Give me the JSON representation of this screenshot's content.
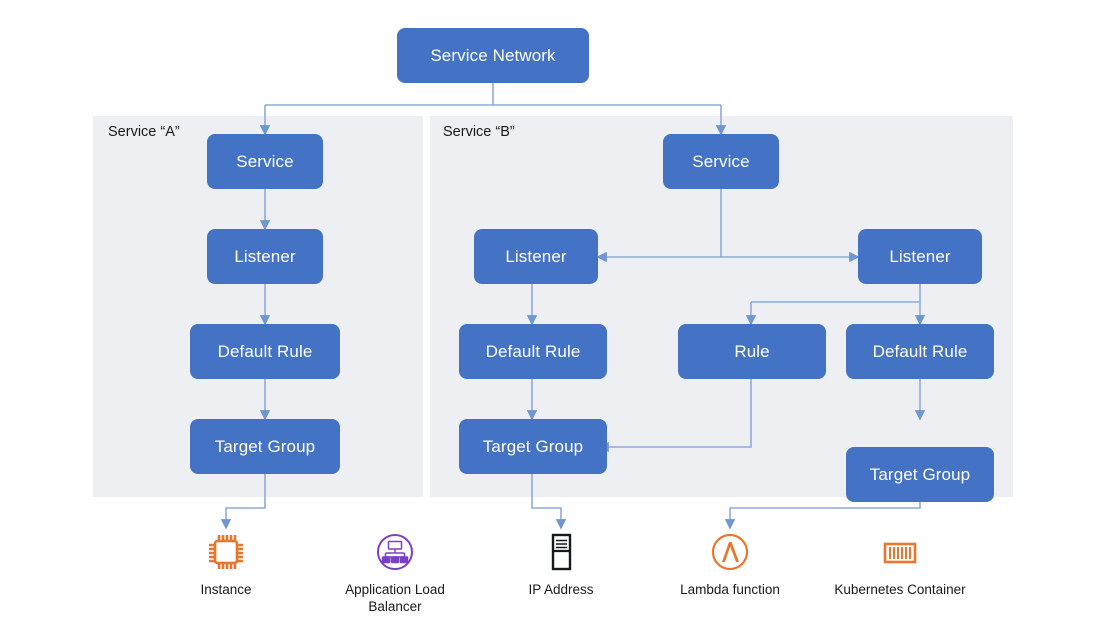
{
  "diagram": {
    "title": "Service Network",
    "colors": {
      "node_fill": "#4472C4",
      "node_text": "#FFFFFF",
      "group_bg": "#EDEFF2",
      "connector": "#8FAADC",
      "orange": "#E8762D",
      "purple": "#7D3FC7",
      "black": "#16191F"
    }
  },
  "root": {
    "label": "Service Network"
  },
  "groups": [
    {
      "id": "group-a",
      "label": "Service “A”"
    },
    {
      "id": "group-b",
      "label": "Service “B”"
    }
  ],
  "nodes": {
    "a_service": "Service",
    "a_listener": "Listener",
    "a_default_rule": "Default Rule",
    "a_target_group": "Target Group",
    "b_service": "Service",
    "b_listener_left": "Listener",
    "b_listener_right": "Listener",
    "b_default_rule_left": "Default Rule",
    "b_rule": "Rule",
    "b_default_rule_right": "Default Rule",
    "b_target_group_left": "Target Group",
    "b_target_group_right": "Target Group"
  },
  "legend": [
    {
      "icon": "instance-chip-icon",
      "label": "Instance"
    },
    {
      "icon": "application-load-balancer-icon",
      "label": "Application Load Balancer"
    },
    {
      "icon": "ip-address-server-icon",
      "label": "IP Address"
    },
    {
      "icon": "lambda-function-icon",
      "label": "Lambda function"
    },
    {
      "icon": "kubernetes-container-icon",
      "label": "Kubernetes Container"
    }
  ]
}
